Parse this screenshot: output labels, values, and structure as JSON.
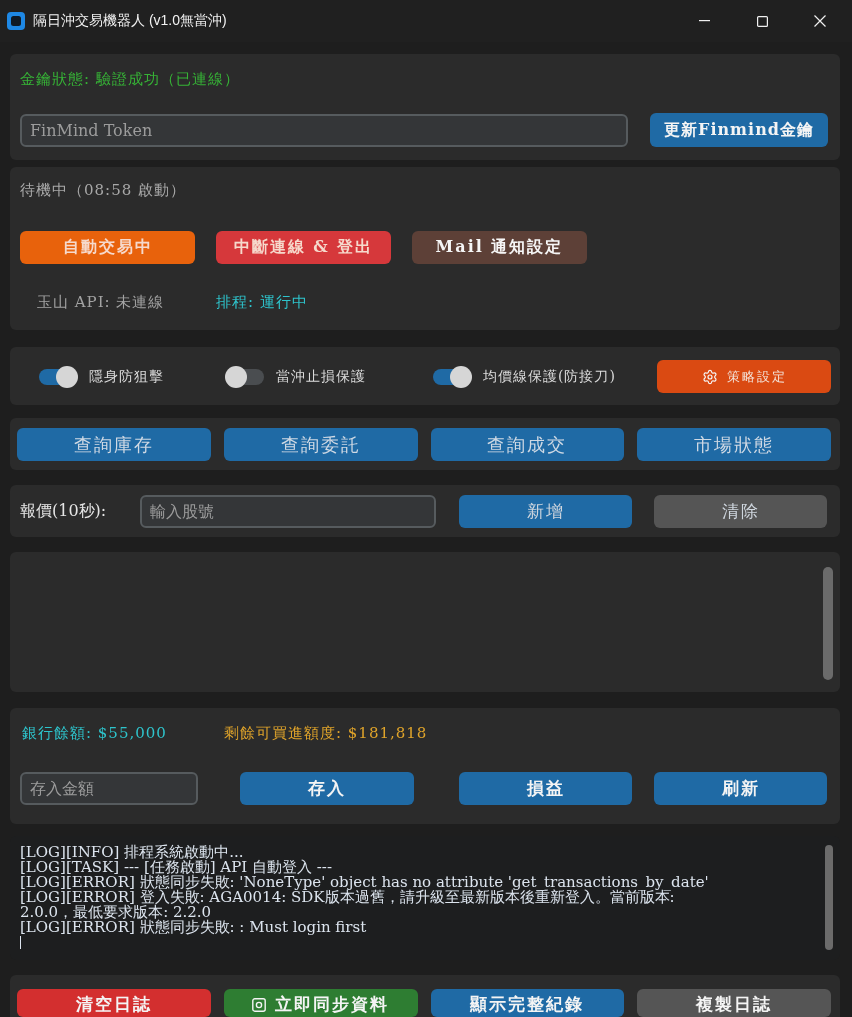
{
  "window": {
    "title": "隔日沖交易機器人 (v1.0無當沖)"
  },
  "token_panel": {
    "status": "金鑰狀態: 驗證成功（已連線）",
    "token_field": {
      "placeholder": "FinMind Token"
    },
    "update_button": "更新Finmind金鑰"
  },
  "trading_panel": {
    "status": "待機中（08:58 啟動）",
    "buttons": [
      {
        "label": "自動交易中",
        "color": "#e8620c"
      },
      {
        "label": "中斷連線 & 登出",
        "color": "#d6383b"
      },
      {
        "label": "Mail 通知設定",
        "color": "#5d4037"
      }
    ],
    "indicators": [
      {
        "text": "玉山 API: 未連線",
        "color": "#a3a3a3"
      },
      {
        "text": "排程: 運行中",
        "color": "#2ec4cc"
      }
    ]
  },
  "protection_panel": {
    "switches": [
      {
        "label": "隱身防狙擊",
        "on": true
      },
      {
        "label": "當沖止損保護",
        "on": false
      },
      {
        "label": "均價線保護(防接刀)",
        "on": true
      }
    ],
    "strategy_button": "策略設定"
  },
  "query_buttons": [
    "查詢庫存",
    "查詢委託",
    "查詢成交",
    "市場狀態"
  ],
  "quote_panel": {
    "label": "報價(10秒):",
    "stock_field": {
      "placeholder": "輸入股號"
    },
    "buttons": [
      {
        "label": "新增",
        "color": "#1f6aa5"
      },
      {
        "label": "清除",
        "color": "#555555"
      }
    ]
  },
  "account_panel": {
    "figures": [
      {
        "text": "銀行餘額: $55,000",
        "color": "#2ec4cc"
      },
      {
        "text": "剩餘可買進額度: $181,818",
        "color": "#e0a42a"
      }
    ],
    "deposit_field": {
      "placeholder": "存入金額"
    },
    "buttons": [
      "存入",
      "損益",
      "刷新"
    ]
  },
  "log": {
    "lines": [
      "[LOG][INFO] 排程系統啟動中...",
      "[LOG][TASK] --- [任務啟動] API 自動登入 ---",
      "[LOG][ERROR] 狀態同步失敗: 'NoneType' object has no attribute 'get_transactions_by_date'",
      "[LOG][ERROR] 登入失敗: AGA0014: SDK版本過舊，請升級至最新版本後重新登入。當前版本: 2.0.0，最低要求版本: 2.2.0",
      "[LOG][ERROR] 狀態同步失敗: : Must login first"
    ]
  },
  "log_buttons": [
    {
      "label": "清空日誌",
      "color": "#d32f2f",
      "kind": "plain"
    },
    {
      "label": "立即同步資料",
      "color": "#2e7d32",
      "kind": "icon"
    },
    {
      "label": "顯示完整紀錄",
      "color": "#1f6aa5",
      "kind": "plain"
    },
    {
      "label": "複製日誌",
      "color": "#555555",
      "kind": "plain"
    }
  ]
}
